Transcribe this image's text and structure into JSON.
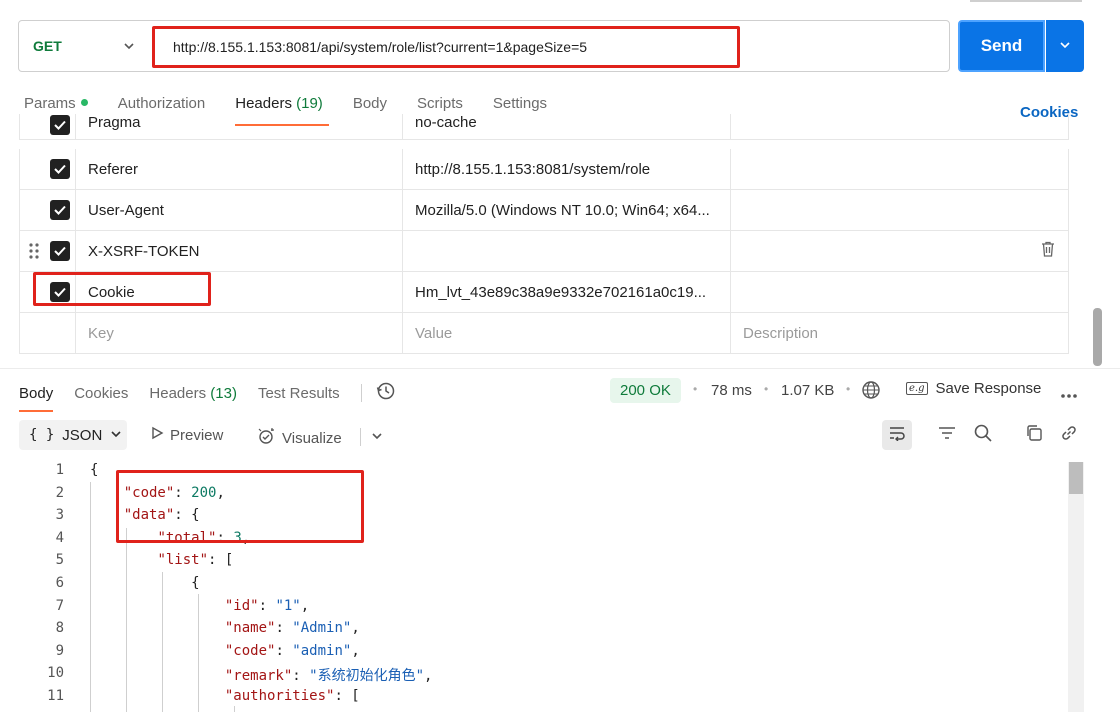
{
  "request": {
    "method": "GET",
    "url": "http://8.155.1.153:8081/api/system/role/list?current=1&pageSize=5",
    "send_label": "Send"
  },
  "tabs": [
    {
      "label": "Params",
      "count": ""
    },
    {
      "label": "Authorization",
      "count": ""
    },
    {
      "label": "Headers",
      "count": "(19)"
    },
    {
      "label": "Body",
      "count": ""
    },
    {
      "label": "Scripts",
      "count": ""
    },
    {
      "label": "Settings",
      "count": ""
    }
  ],
  "cookies_link": "Cookies",
  "headers": [
    {
      "key": "Pragma",
      "value": "no-cache"
    },
    {
      "key": "Referer",
      "value": "http://8.155.1.153:8081/system/role"
    },
    {
      "key": "User-Agent",
      "value": "Mozilla/5.0 (Windows NT 10.0; Win64; x64..."
    },
    {
      "key": "X-XSRF-TOKEN",
      "value": ""
    },
    {
      "key": "Cookie",
      "value": "Hm_lvt_43e89c38a9e9332e702161a0c19..."
    }
  ],
  "headers_placeholder": {
    "key": "Key",
    "value": "Value",
    "description": "Description"
  },
  "response": {
    "tabs": [
      {
        "label": "Body",
        "count": ""
      },
      {
        "label": "Cookies",
        "count": ""
      },
      {
        "label": "Headers",
        "count": "(13)"
      },
      {
        "label": "Test Results",
        "count": ""
      }
    ],
    "status": "200 OK",
    "time": "78 ms",
    "size": "1.07 KB",
    "save_label": "Save Response",
    "save_icon_text": "e.g",
    "format": "JSON",
    "format_icon_text": "{ }",
    "preview_label": "Preview",
    "visualize_label": "Visualize"
  },
  "code_lines": [
    {
      "n": "1",
      "text": "{"
    },
    {
      "n": "2",
      "text": "    \"code\": 200,"
    },
    {
      "n": "3",
      "text": "    \"data\": {"
    },
    {
      "n": "4",
      "text": "        \"total\": 3,"
    },
    {
      "n": "5",
      "text": "        \"list\": ["
    },
    {
      "n": "6",
      "text": "            {"
    },
    {
      "n": "7",
      "text": "                \"id\": \"1\","
    },
    {
      "n": "8",
      "text": "                \"name\": \"Admin\","
    },
    {
      "n": "9",
      "text": "                \"code\": \"admin\","
    },
    {
      "n": "10",
      "text": "                \"remark\": \"系统初始化角色\","
    },
    {
      "n": "11",
      "text": "                \"authorities\": ["
    }
  ]
}
